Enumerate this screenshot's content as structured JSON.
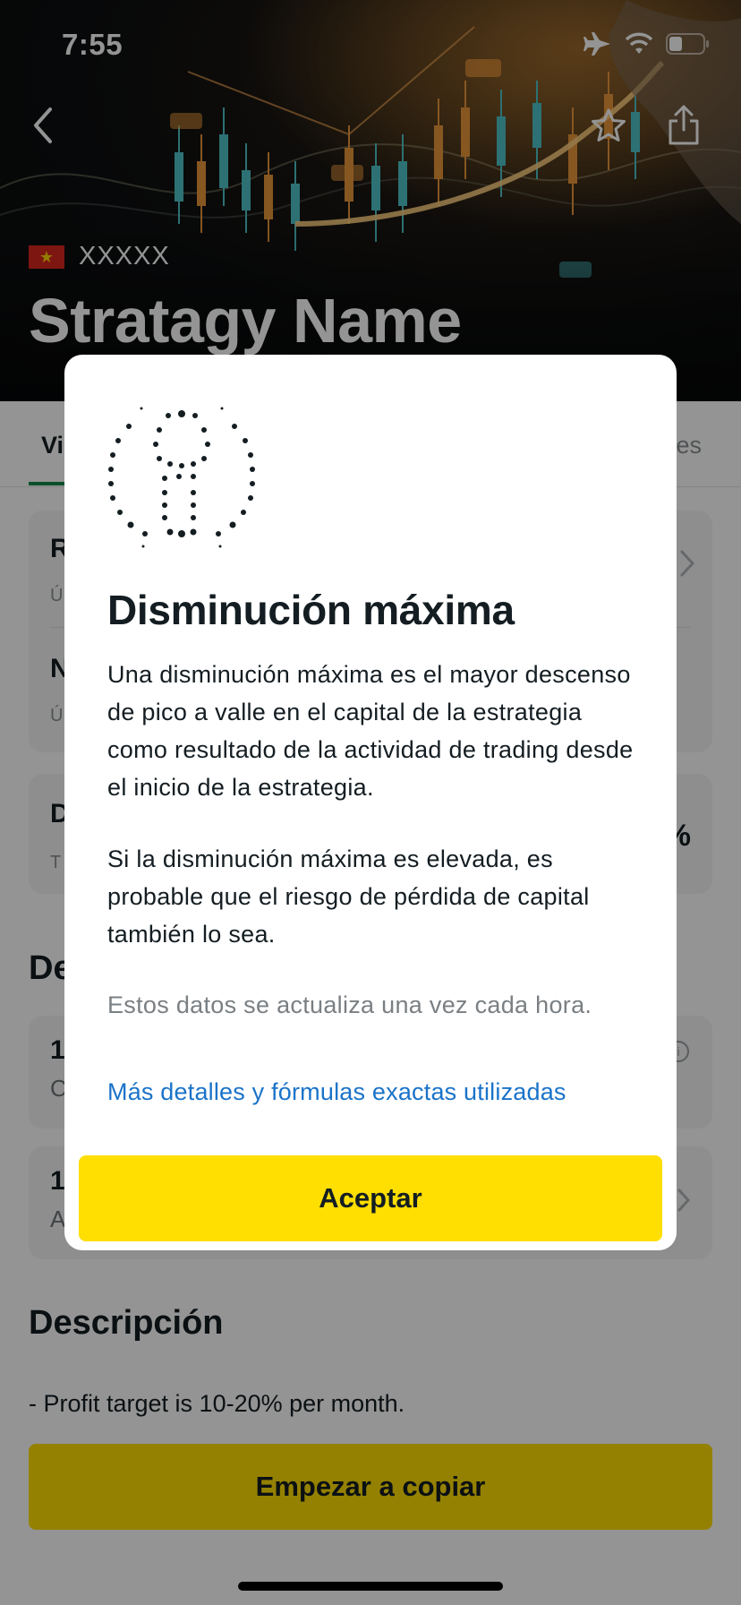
{
  "status_bar": {
    "time": "7:55"
  },
  "header": {
    "country_code": "XXXXX",
    "title": "Stratagy Name",
    "icons": [
      "back-arrow-icon",
      "star-icon",
      "share-icon",
      "airplane-icon",
      "wifi-icon",
      "battery-icon"
    ]
  },
  "tabs": {
    "left_partial": "Vi",
    "right_partial": "es"
  },
  "cards": {
    "card1_top_letter": "R",
    "card1_top_sub": "Ú",
    "card1_bottom_letter": "N",
    "card1_bottom_sub": "Ú",
    "card2_letter": "D",
    "card2_sub": "T",
    "card2_value": "%"
  },
  "section_de": "De",
  "detail_cards": [
    {
      "value": "1",
      "sub": "C"
    },
    {
      "value": "1",
      "sub": "A"
    }
  ],
  "description": {
    "title": "Descripción",
    "text": "- Profit target is 10-20% per month."
  },
  "copy_button_label": "Empezar a copiar",
  "modal": {
    "title": "Disminución máxima",
    "paragraph1": "Una disminución máxima es el mayor descenso de pico a valle en el capital de la estrategia como resultado de la actividad de trading desde el inicio de la estrategia.",
    "paragraph2": "Si la disminución máxima es elevada, es probable que el riesgo de pérdida de capital también lo sea.",
    "note": "Estos datos se actualiza una vez cada hora.",
    "link": "Más detalles y fórmulas exactas utilizadas",
    "accept_label": "Aceptar"
  },
  "colors": {
    "accent_yellow": "#ffde02",
    "link_blue": "#1a73c9",
    "tab_green": "#158b4b",
    "text_dark": "#141d22"
  }
}
